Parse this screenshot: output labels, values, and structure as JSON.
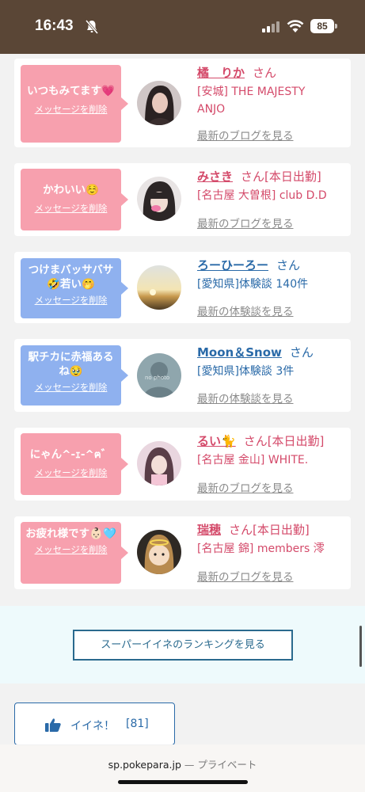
{
  "status": {
    "time": "16:43",
    "battery": "85"
  },
  "cards": [
    {
      "message": "いつもみてます💗",
      "delete": "メッセージを削除",
      "name": "橘　りか",
      "san": "さん",
      "detail": "[安城] THE MAJESTY ANJO",
      "more": "最新のブログを見る",
      "kind": "pink"
    },
    {
      "message": "かわいい☺️",
      "delete": "メッセージを削除",
      "name": "みさき",
      "san": "さん[本日出勤]",
      "detail": "[名古屋 大曽根] club D.D",
      "more": "最新のブログを見る",
      "kind": "pink"
    },
    {
      "message": "つけまバッサバサ🤣若い🤭",
      "delete": "メッセージを削除",
      "name": "ろーひーろー",
      "san": "さん",
      "detail": "[愛知県]体験談 140件",
      "more": "最新の体験談を見る",
      "kind": "blue"
    },
    {
      "message": "駅チカに赤福あるね🥹",
      "delete": "メッセージを削除",
      "name": "Moon＆Snow",
      "san": "さん",
      "detail": "[愛知県]体験談 3件",
      "more": "最新の体験談を見る",
      "kind": "blue"
    },
    {
      "message": "にゃん^-ｪ-^ฅ゛",
      "delete": "メッセージを削除",
      "name": "るい🐈",
      "san": "さん[本日出勤]",
      "detail": "[名古屋 金山] WHITE.",
      "more": "最新のブログを見る",
      "kind": "pink"
    },
    {
      "message": "お疲れ様です👶🏻🩵",
      "delete": "メッセージを削除",
      "name": "瑞穂",
      "san": "さん[本日出勤]",
      "detail": "[名古屋 錦] members 澪",
      "more": "最新のブログを見る",
      "kind": "pink"
    }
  ],
  "ranking": {
    "button_label": "スーパーイイネのランキングを見る"
  },
  "like": {
    "label": "イイネ！",
    "count": "[81]"
  },
  "browser": {
    "domain": "sp.pokepara.jp",
    "separator": " — ",
    "mode": "プライベート"
  },
  "colors": {
    "pink_bubble": "#f7a0ae",
    "blue_bubble": "#8fb1ef",
    "pink_text": "#d44a6a",
    "blue_text": "#2a6aa8",
    "status_bar": "#5a4636"
  }
}
